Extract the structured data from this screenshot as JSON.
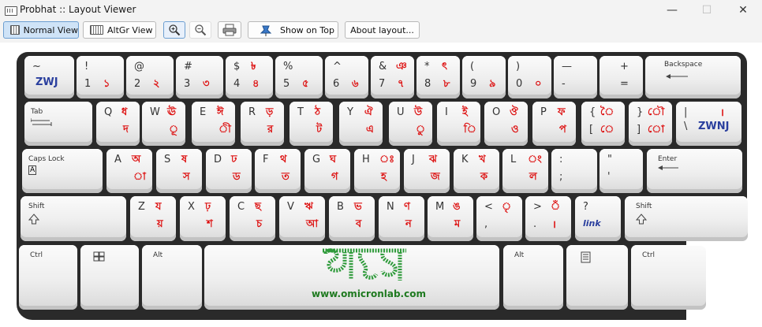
{
  "window": {
    "title": "Probhat :: Layout Viewer",
    "minimize": "—",
    "maximize": "☐",
    "close": "✕"
  },
  "toolbar": {
    "normal_view": "Normal View",
    "altgr_view": "AltGr View",
    "zoom_in": "zoom-in",
    "zoom_out": "zoom-out",
    "print": "print",
    "show_on_top": "Show on Top",
    "about": "About layout..."
  },
  "row1": [
    {
      "tl": "~",
      "bl": "",
      "tr": "",
      "br": ""
    },
    {
      "tl": "!",
      "bl": "1",
      "tr": "",
      "br": "১"
    },
    {
      "tl": "@",
      "bl": "2",
      "tr": "",
      "br": "২"
    },
    {
      "tl": "#",
      "bl": "3",
      "tr": "",
      "br": "৩"
    },
    {
      "tl": "$",
      "bl": "4",
      "tr": "৳",
      "br": "৪"
    },
    {
      "tl": "%",
      "bl": "5",
      "tr": "",
      "br": "৫"
    },
    {
      "tl": "^",
      "bl": "6",
      "tr": "",
      "br": "৬"
    },
    {
      "tl": "&",
      "bl": "7",
      "tr": "ঞ",
      "br": "৭"
    },
    {
      "tl": "*",
      "bl": "8",
      "tr": "ৎ",
      "br": "৮"
    },
    {
      "tl": "(",
      "bl": "9",
      "tr": "",
      "br": "৯"
    },
    {
      "tl": ")",
      "bl": "0",
      "tr": "",
      "br": "০"
    },
    {
      "tl": "—",
      "bl": "-",
      "tr": "",
      "br": ""
    },
    {
      "tl": "+",
      "bl": "=",
      "tr": "",
      "br": ""
    }
  ],
  "row1_zwj": "ZWJ",
  "backspace": "Backspace",
  "tab": "Tab",
  "row2": [
    {
      "tl": "Q",
      "tr": "ধ",
      "br": "দ"
    },
    {
      "tl": "W",
      "tr": "ঊ",
      "br": "ূ"
    },
    {
      "tl": "E",
      "tr": "ঈ",
      "br": "ী"
    },
    {
      "tl": "R",
      "tr": "ড়",
      "br": "র"
    },
    {
      "tl": "T",
      "tr": "ঠ",
      "br": "ট"
    },
    {
      "tl": "Y",
      "tr": "ঐ",
      "br": "এ"
    },
    {
      "tl": "U",
      "tr": "উ",
      "br": "ু"
    },
    {
      "tl": "I",
      "tr": "ই",
      "br": "ি"
    },
    {
      "tl": "O",
      "tr": "ঔ",
      "br": "ও"
    },
    {
      "tl": "P",
      "tr": "ফ",
      "br": "প"
    },
    {
      "tl": "{",
      "bl": "[",
      "tr": "ৈ",
      "br": "ে"
    },
    {
      "tl": "}",
      "bl": "]",
      "tr": "ৌ",
      "br": "ো"
    }
  ],
  "row2_pipe": {
    "tl": "|",
    "bl": "\\",
    "tr": "।",
    "br": "ZWNJ"
  },
  "caps": "Caps Lock",
  "caps_a": "A",
  "row3": [
    {
      "tl": "A",
      "tr": "অ",
      "br": "া"
    },
    {
      "tl": "S",
      "tr": "ষ",
      "br": "স"
    },
    {
      "tl": "D",
      "tr": "ঢ",
      "br": "ড"
    },
    {
      "tl": "F",
      "tr": "থ",
      "br": "ত"
    },
    {
      "tl": "G",
      "tr": "ঘ",
      "br": "গ"
    },
    {
      "tl": "H",
      "tr": "ঃ",
      "br": "হ"
    },
    {
      "tl": "J",
      "tr": "ঝ",
      "br": "জ"
    },
    {
      "tl": "K",
      "tr": "খ",
      "br": "ক"
    },
    {
      "tl": "L",
      "tr": "ং",
      "br": "ল"
    },
    {
      "tl": ":",
      "bl": ";",
      "tr": "",
      "br": ""
    },
    {
      "tl": "\"",
      "bl": "'",
      "tr": "",
      "br": ""
    }
  ],
  "enter": "Enter",
  "shift_label": "Shift",
  "row4": [
    {
      "tl": "Z",
      "tr": "য",
      "br": "য়"
    },
    {
      "tl": "X",
      "tr": "ঢ়",
      "br": "শ"
    },
    {
      "tl": "C",
      "tr": "ছ",
      "br": "চ"
    },
    {
      "tl": "V",
      "tr": "ঋ",
      "br": "আ"
    },
    {
      "tl": "B",
      "tr": "ভ",
      "br": "ব"
    },
    {
      "tl": "N",
      "tr": "ণ",
      "br": "ন"
    },
    {
      "tl": "M",
      "tr": "ঙ",
      "br": "ম"
    },
    {
      "tl": "<",
      "bl": ",",
      "tr": "ৃ",
      "br": ""
    },
    {
      "tl": ">",
      "bl": ".",
      "tr": "ঁ",
      "br": "।"
    },
    {
      "tl": "?",
      "bl": "",
      "tr": "",
      "br": ""
    }
  ],
  "row4_link": "link",
  "ctrl": "Ctrl",
  "alt": "Alt",
  "logo_url": "www.omicronlab.com"
}
